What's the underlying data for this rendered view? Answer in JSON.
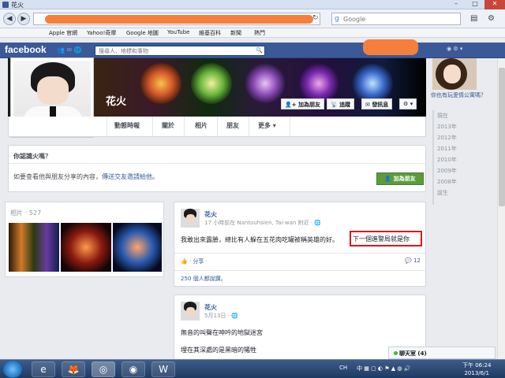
{
  "window": {
    "title": "花火"
  },
  "browser": {
    "search_placeholder": "Google",
    "bookmarks": [
      "Apple 官網",
      "Yahoo!奇摩",
      "Google 地圖",
      "YouTube",
      "維基百科",
      "新聞",
      "熱門"
    ]
  },
  "facebook": {
    "logo": "facebook",
    "search_placeholder": "搜尋人、地標和事物"
  },
  "profile": {
    "name": "花火",
    "buttons": {
      "add_friend": "加為朋友",
      "follow": "追蹤",
      "message": "發訊息",
      "more": "⚙ ▾"
    },
    "tabs": [
      "動態時報",
      "關於",
      "相片",
      "朋友",
      "更多 ▾"
    ]
  },
  "know_card": {
    "title": "你認識火嗎？",
    "text": "如要查看他與朋友分享的內容，",
    "link": "傳送交友邀請給他。",
    "button": "加為朋友"
  },
  "photos": {
    "title": "相片",
    "count": "· 527"
  },
  "post1": {
    "author": "花火",
    "meta": "17 小時前在 Nantouhsien, Tai-wan 附近 · ",
    "body": "我敢出來露臉，總比有人躲在五花肉吃罐被稱英雄的好。",
    "highlight": "下一個進警局就是你",
    "share": "· 分享",
    "comments": "12",
    "likes": "250 個人都說讚。"
  },
  "post2": {
    "author": "花火",
    "meta": "5月13日 · ",
    "line1": "無音的叫聲在呻吟的地獄迷宮",
    "line2": "埋在其深處的是黑暗的犧牲"
  },
  "sidebar": {
    "caption": "你也有玩愛情公寓嗎？",
    "years": [
      "現在",
      "2013年",
      "2012年",
      "2011年",
      "2010年",
      "2009年",
      "2008年",
      "誕生"
    ]
  },
  "chat": {
    "label": "聊天室 (4)"
  },
  "taskbar": {
    "tray_text": "CH",
    "clock_line1": "下午 06:24",
    "clock_line2": "2013/6/1"
  }
}
